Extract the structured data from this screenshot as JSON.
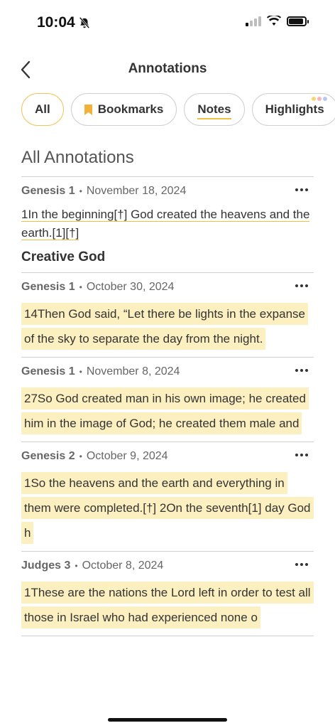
{
  "status_bar": {
    "time": "10:04"
  },
  "header": {
    "title": "Annotations"
  },
  "filters": [
    {
      "label": "All"
    },
    {
      "label": "Bookmarks"
    },
    {
      "label": "Notes"
    },
    {
      "label": "Highlights"
    }
  ],
  "section_title": "All Annotations",
  "annotations": [
    {
      "ref": "Genesis 1",
      "date": "November 18, 2024",
      "text": "1In the beginning[†] God created the heavens and the earth.[1][†]",
      "note": "Creative God"
    },
    {
      "ref": "Genesis 1",
      "date": "October 30, 2024",
      "text": "14Then God said, “Let there be lights in the expanse of the sky to separate the day from the night."
    },
    {
      "ref": "Genesis 1",
      "date": "November 8, 2024",
      "text": "27So God created man in his own image; he created him in the image of God; he created them male and"
    },
    {
      "ref": "Genesis 2",
      "date": "October 9, 2024",
      "text": "1So the heavens and the earth and everything in them were completed.[†] 2On the seventh[1] day God h"
    },
    {
      "ref": "Judges 3",
      "date": "October 8, 2024",
      "text": "1These are the nations the Lord left in order to test all those in Israel who had experienced none o"
    }
  ],
  "colors": {
    "accent": "#f2c55a",
    "highlight": "#fdf0c0",
    "underline": "#f0c040"
  }
}
